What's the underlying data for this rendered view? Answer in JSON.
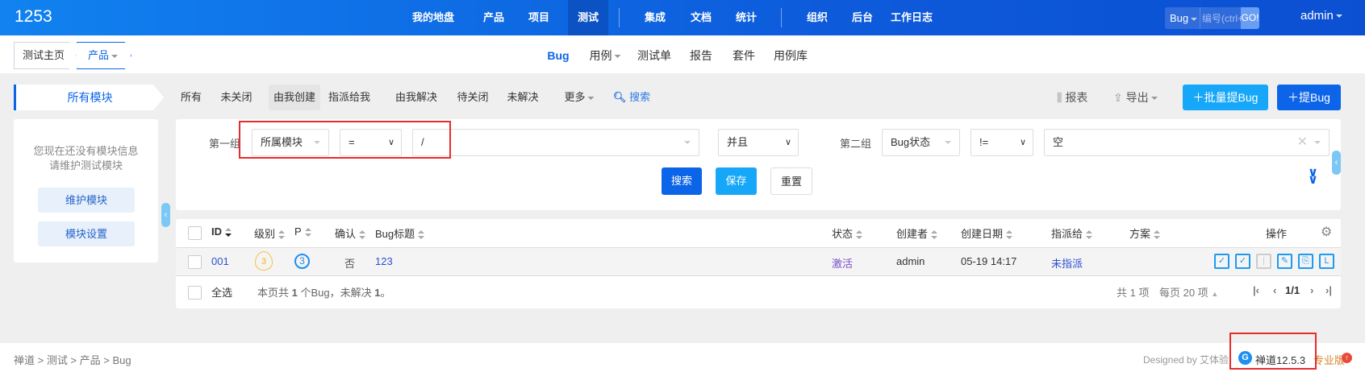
{
  "header": {
    "logo": "1253",
    "nav": [
      "我的地盘",
      "产品",
      "项目",
      "测试",
      "集成",
      "文档",
      "统计",
      "组织",
      "后台",
      "工作日志"
    ],
    "active_nav": "测试",
    "search_type": "Bug",
    "search_placeholder": "编号(ctrl+g)",
    "go_label": "GO!",
    "user": "admin"
  },
  "breadcrumb": {
    "home": "测试主页",
    "product": "产品"
  },
  "subnav": [
    "Bug",
    "用例",
    "测试单",
    "报告",
    "套件",
    "用例库"
  ],
  "module_tab": "所有模块",
  "filters": [
    "所有",
    "未关闭",
    "由我创建",
    "指派给我",
    "由我解决",
    "待关闭",
    "未解决",
    "更多",
    "搜索"
  ],
  "toolbar": {
    "report": "报表",
    "export": "导出",
    "batch_create": "批量提Bug",
    "create": "提Bug"
  },
  "sidebar": {
    "line1": "您现在还没有模块信息",
    "line2": "请维护测试模块",
    "maintain": "维护模块",
    "settings": "模块设置"
  },
  "search": {
    "group1_label": "第一组",
    "field1": "所属模块",
    "op1": "=",
    "value1": "/",
    "logic": "并且",
    "group2_label": "第二组",
    "field2": "Bug状态",
    "op2": "!=",
    "value2": "空",
    "search_btn": "搜索",
    "save_btn": "保存",
    "reset_btn": "重置"
  },
  "table": {
    "columns": [
      "ID",
      "级别",
      "P",
      "确认",
      "Bug标题",
      "状态",
      "创建者",
      "创建日期",
      "指派给",
      "方案",
      "操作"
    ],
    "rows": [
      {
        "id": "001",
        "severity": "3",
        "priority": "3",
        "confirmed": "否",
        "title": "123",
        "status": "激活",
        "creator": "admin",
        "date": "05-19 14:17",
        "assigned": "未指派",
        "resolution": ""
      }
    ],
    "select_all": "全选",
    "summary_pre": "本页共 ",
    "summary_count": "1",
    "summary_mid": " 个Bug，未解决 ",
    "summary_unresolved": "1",
    "summary_end": "。",
    "total": "共 1 项",
    "per_page": "每页 20 项",
    "page": "1/1"
  },
  "footer": {
    "breadcrumb": "禅道 > 测试 > 产品 > Bug",
    "designed_by": "Designed by 艾体验",
    "version": "禅道12.5.3",
    "edition": "专业版"
  },
  "colors": {
    "primary": "#0c64e8",
    "info": "#17a7f8",
    "link": "#2e4fd1",
    "status_active": "#7b4fc9"
  }
}
